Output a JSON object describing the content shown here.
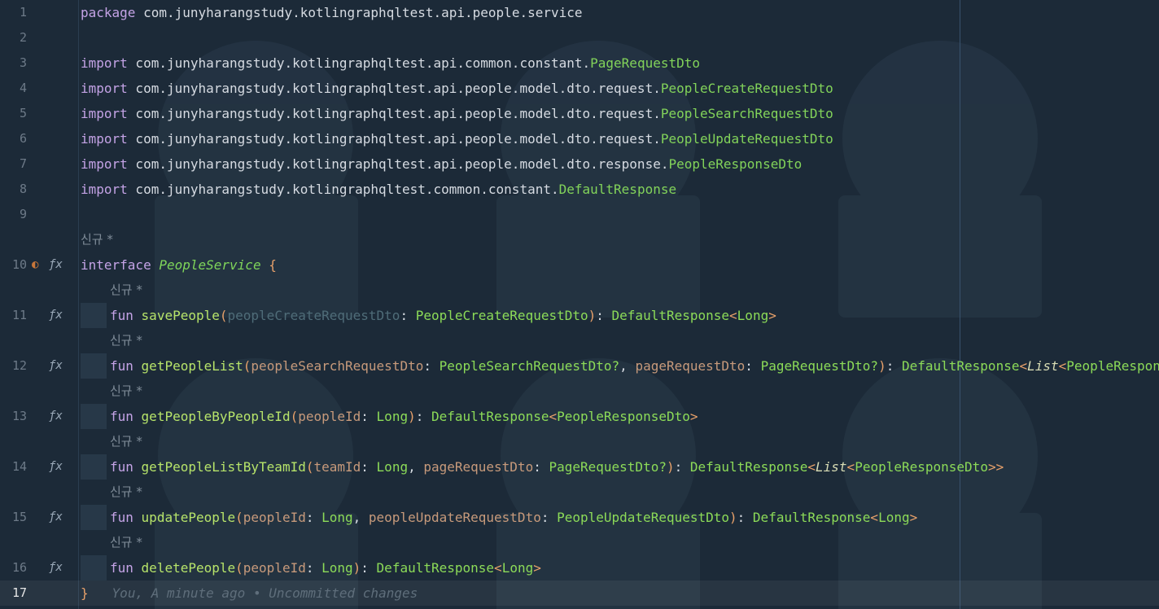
{
  "line_numbers": [
    "1",
    "2",
    "3",
    "4",
    "5",
    "6",
    "7",
    "8",
    "9",
    "10",
    "11",
    "12",
    "13",
    "14",
    "15",
    "16",
    "17"
  ],
  "colors": {
    "background": "#1c2a38",
    "keyword": "#c4a3e6",
    "class": "#82d35a",
    "function": "#b7e46a",
    "parameter": "#c79a7b",
    "bracket": "#e8a16a"
  },
  "code": {
    "l1": {
      "kw": "package",
      "rest": " com.junyharangstudy.kotlingraphqltest.api.people.service"
    },
    "l3": {
      "kw": "import",
      "pkg": " com.junyharangstudy.kotlingraphqltest.api.common.constant.",
      "cls": "PageRequestDto"
    },
    "l4": {
      "kw": "import",
      "pkg": " com.junyharangstudy.kotlingraphqltest.api.people.model.dto.request.",
      "cls": "PeopleCreateRequestDto"
    },
    "l5": {
      "kw": "import",
      "pkg": " com.junyharangstudy.kotlingraphqltest.api.people.model.dto.request.",
      "cls": "PeopleSearchRequestDto"
    },
    "l6": {
      "kw": "import",
      "pkg": " com.junyharangstudy.kotlingraphqltest.api.people.model.dto.request.",
      "cls": "PeopleUpdateRequestDto"
    },
    "l7": {
      "kw": "import",
      "pkg": " com.junyharangstudy.kotlingraphqltest.api.people.model.dto.response.",
      "cls": "PeopleResponseDto"
    },
    "l8": {
      "kw": "import",
      "pkg": " com.junyharangstudy.kotlingraphqltest.common.constant.",
      "cls": "DefaultResponse"
    },
    "hint": "신규 *",
    "l10": {
      "kw": "interface",
      "name": "PeopleService",
      "brace": "{"
    },
    "l11": {
      "fun": "fun",
      "name": "savePeople",
      "p1": "peopleCreateRequestDto",
      "t1": "PeopleCreateRequestDto",
      "ret": "DefaultResponse",
      "gen": "Long"
    },
    "l12": {
      "fun": "fun",
      "name": "getPeopleList",
      "p1": "peopleSearchRequestDto",
      "t1": "PeopleSearchRequestDto?",
      "p2": "pageRequestDto",
      "t2": "PageRequestDto?",
      "ret": "DefaultResponse",
      "list": "List",
      "gen": "PeopleResponseDto"
    },
    "l13": {
      "fun": "fun",
      "name": "getPeopleByPeopleId",
      "p1": "peopleId",
      "t1": "Long",
      "ret": "DefaultResponse",
      "gen": "PeopleResponseDto"
    },
    "l14": {
      "fun": "fun",
      "name": "getPeopleListByTeamId",
      "p1": "teamId",
      "t1": "Long",
      "p2": "pageRequestDto",
      "t2": "PageRequestDto?",
      "ret": "DefaultResponse",
      "list": "List",
      "gen": "PeopleResponseDto"
    },
    "l15": {
      "fun": "fun",
      "name": "updatePeople",
      "p1": "peopleId",
      "t1": "Long",
      "p2": "peopleUpdateRequestDto",
      "t2": "PeopleUpdateRequestDto",
      "ret": "DefaultResponse",
      "gen": "Long"
    },
    "l16": {
      "fun": "fun",
      "name": "deletePeople",
      "p1": "peopleId",
      "t1": "Long",
      "ret": "DefaultResponse",
      "gen": "Long"
    },
    "l17": {
      "brace": "}",
      "blame": "You, A minute ago • Uncommitted changes"
    }
  },
  "gutter_icons": {
    "fx": "ƒx",
    "impl": "◐"
  }
}
